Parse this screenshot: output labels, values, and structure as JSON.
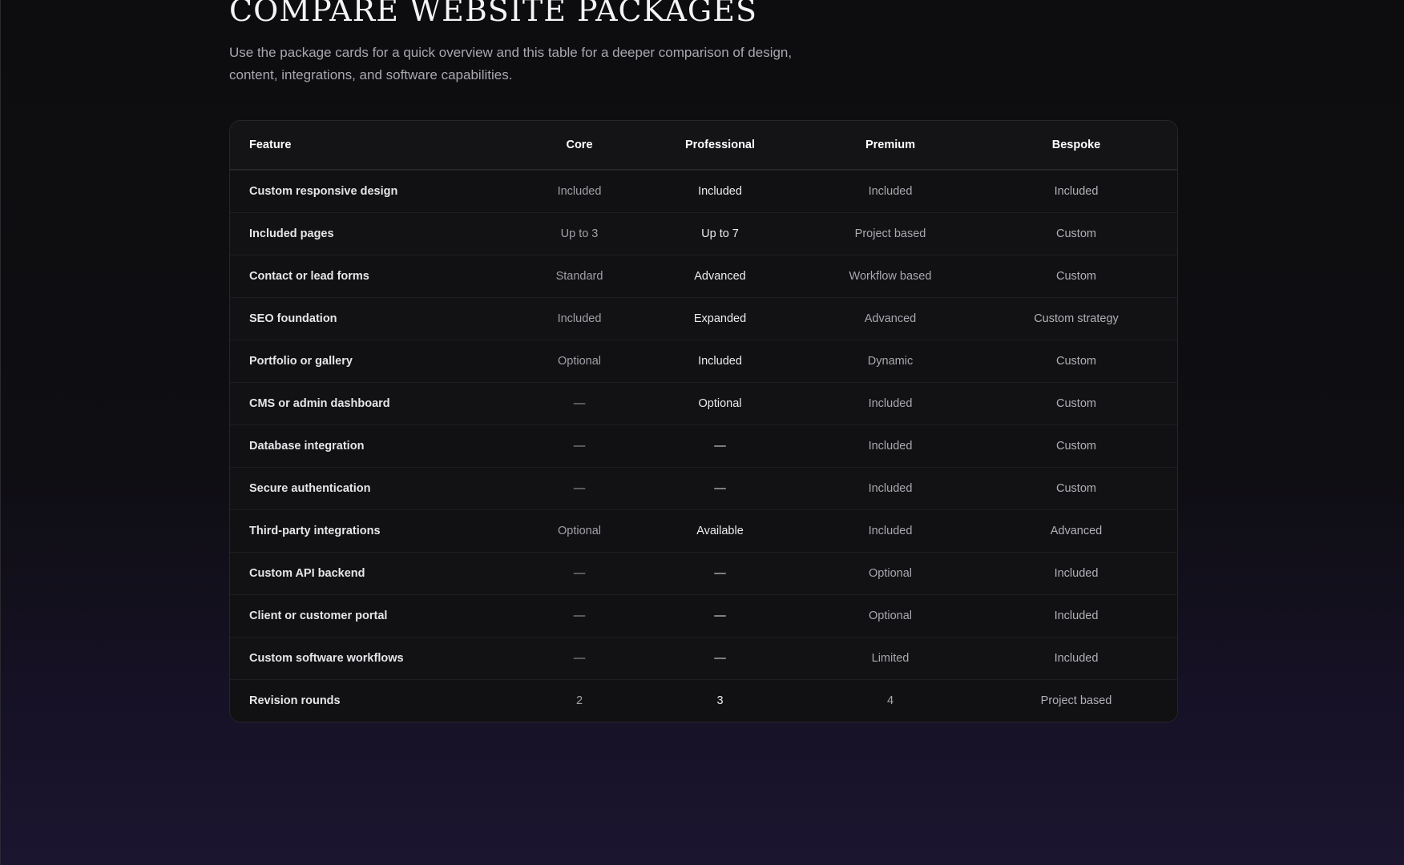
{
  "page": {
    "title": "COMPARE WEBSITE PACKAGES",
    "intro": "Use the package cards for a quick overview and this table for a deeper comparison of design, content, integrations, and software capabilities."
  },
  "table": {
    "headers": [
      "Feature",
      "Core",
      "Professional",
      "Premium",
      "Bespoke"
    ],
    "rows": [
      [
        "Custom responsive design",
        "Included",
        "Included",
        "Included",
        "Included"
      ],
      [
        "Included pages",
        "Up to 3",
        "Up to 7",
        "Project based",
        "Custom"
      ],
      [
        "Contact or lead forms",
        "Standard",
        "Advanced",
        "Workflow based",
        "Custom"
      ],
      [
        "SEO foundation",
        "Included",
        "Expanded",
        "Advanced",
        "Custom strategy"
      ],
      [
        "Portfolio or gallery",
        "Optional",
        "Included",
        "Dynamic",
        "Custom"
      ],
      [
        "CMS or admin dashboard",
        "—",
        "Optional",
        "Included",
        "Custom"
      ],
      [
        "Database integration",
        "—",
        "—",
        "Included",
        "Custom"
      ],
      [
        "Secure authentication",
        "—",
        "—",
        "Included",
        "Custom"
      ],
      [
        "Third-party integrations",
        "Optional",
        "Available",
        "Included",
        "Advanced"
      ],
      [
        "Custom API backend",
        "—",
        "—",
        "Optional",
        "Included"
      ],
      [
        "Client or customer portal",
        "—",
        "—",
        "Optional",
        "Included"
      ],
      [
        "Custom software workflows",
        "—",
        "—",
        "Limited",
        "Included"
      ],
      [
        "Revision rounds",
        "2",
        "3",
        "4",
        "Project based"
      ]
    ]
  },
  "colors": {
    "background": "#0e0e10",
    "background_bottom": "#1b1530",
    "card": "#121214",
    "border": "#26262b"
  }
}
